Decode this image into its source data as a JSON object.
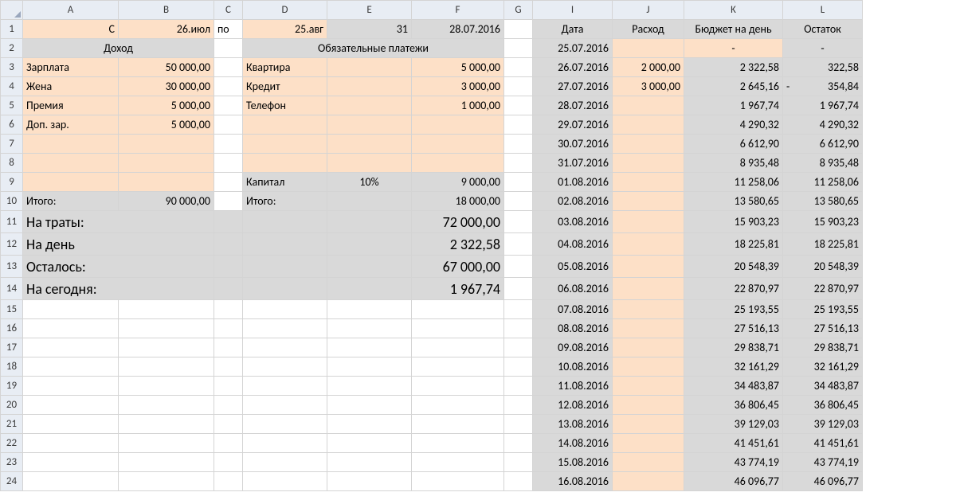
{
  "columns": [
    "A",
    "B",
    "C",
    "D",
    "E",
    "F",
    "G",
    "I",
    "J",
    "K",
    "L"
  ],
  "row_headers": [
    "1",
    "2",
    "3",
    "4",
    "5",
    "6",
    "7",
    "8",
    "9",
    "10",
    "11",
    "12",
    "13",
    "14",
    "15",
    "16",
    "17",
    "18",
    "19",
    "20",
    "21",
    "22",
    "23",
    "24"
  ],
  "r1": {
    "A": "С",
    "B": "26.июл",
    "C": "по",
    "D": "25.авг",
    "E": "31",
    "F": "28.07.2016",
    "I": "Дата",
    "J": "Расход",
    "K": "Бюджет на день",
    "L": "Остаток"
  },
  "r2": {
    "AB": "Доход",
    "DEF": "Обязательные платежи",
    "I": "25.07.2016",
    "K": "-",
    "L": "-"
  },
  "income": [
    {
      "label": "Зарплата",
      "val": "50 000,00"
    },
    {
      "label": "Жена",
      "val": "30 000,00"
    },
    {
      "label": "Премия",
      "val": "5 000,00"
    },
    {
      "label": "Доп. зар.",
      "val": "5 000,00"
    }
  ],
  "payments": [
    {
      "label": "Квартира",
      "val": "5 000,00"
    },
    {
      "label": "Кредит",
      "val": "3 000,00"
    },
    {
      "label": "Телефон",
      "val": "1 000,00"
    }
  ],
  "capital": {
    "label": "Капитал",
    "pct": "10%",
    "val": "9 000,00"
  },
  "totals": {
    "income_label": "Итого:",
    "income_val": "90 000,00",
    "pay_label": "Итого:",
    "pay_val": "18 000,00"
  },
  "summary": [
    {
      "label": "На траты:",
      "val": "72 000,00"
    },
    {
      "label": "На день",
      "val": "2 322,58"
    },
    {
      "label": "Осталось:",
      "val": "67 000,00"
    },
    {
      "label": "На сегодня:",
      "val": "1 967,74"
    }
  ],
  "budget_rows": [
    {
      "date": "26.07.2016",
      "exp": "2 000,00",
      "bud": "2 322,58",
      "rest": "322,58"
    },
    {
      "date": "27.07.2016",
      "exp": "3 000,00",
      "bud": "2 645,16",
      "rest": "354,84",
      "neg": true
    },
    {
      "date": "28.07.2016",
      "exp": "",
      "bud": "1 967,74",
      "rest": "1 967,74"
    },
    {
      "date": "29.07.2016",
      "exp": "",
      "bud": "4 290,32",
      "rest": "4 290,32"
    },
    {
      "date": "30.07.2016",
      "exp": "",
      "bud": "6 612,90",
      "rest": "6 612,90"
    },
    {
      "date": "31.07.2016",
      "exp": "",
      "bud": "8 935,48",
      "rest": "8 935,48"
    },
    {
      "date": "01.08.2016",
      "exp": "",
      "bud": "11 258,06",
      "rest": "11 258,06"
    },
    {
      "date": "02.08.2016",
      "exp": "",
      "bud": "13 580,65",
      "rest": "13 580,65"
    },
    {
      "date": "03.08.2016",
      "exp": "",
      "bud": "15 903,23",
      "rest": "15 903,23"
    },
    {
      "date": "04.08.2016",
      "exp": "",
      "bud": "18 225,81",
      "rest": "18 225,81"
    },
    {
      "date": "05.08.2016",
      "exp": "",
      "bud": "20 548,39",
      "rest": "20 548,39"
    },
    {
      "date": "06.08.2016",
      "exp": "",
      "bud": "22 870,97",
      "rest": "22 870,97"
    },
    {
      "date": "07.08.2016",
      "exp": "",
      "bud": "25 193,55",
      "rest": "25 193,55"
    },
    {
      "date": "08.08.2016",
      "exp": "",
      "bud": "27 516,13",
      "rest": "27 516,13"
    },
    {
      "date": "09.08.2016",
      "exp": "",
      "bud": "29 838,71",
      "rest": "29 838,71"
    },
    {
      "date": "10.08.2016",
      "exp": "",
      "bud": "32 161,29",
      "rest": "32 161,29"
    },
    {
      "date": "11.08.2016",
      "exp": "",
      "bud": "34 483,87",
      "rest": "34 483,87"
    },
    {
      "date": "12.08.2016",
      "exp": "",
      "bud": "36 806,45",
      "rest": "36 806,45"
    },
    {
      "date": "13.08.2016",
      "exp": "",
      "bud": "39 129,03",
      "rest": "39 129,03"
    },
    {
      "date": "14.08.2016",
      "exp": "",
      "bud": "41 451,61",
      "rest": "41 451,61"
    },
    {
      "date": "15.08.2016",
      "exp": "",
      "bud": "43 774,19",
      "rest": "43 774,19"
    },
    {
      "date": "16.08.2016",
      "exp": "",
      "bud": "46 096,77",
      "rest": "46 096,77"
    }
  ],
  "col_widths": {
    "rh": 28,
    "A": 120,
    "B": 120,
    "C": 36,
    "D": 106,
    "E": 106,
    "F": 116,
    "G": 36,
    "I": 100,
    "J": 90,
    "K": 124,
    "L": 100
  }
}
